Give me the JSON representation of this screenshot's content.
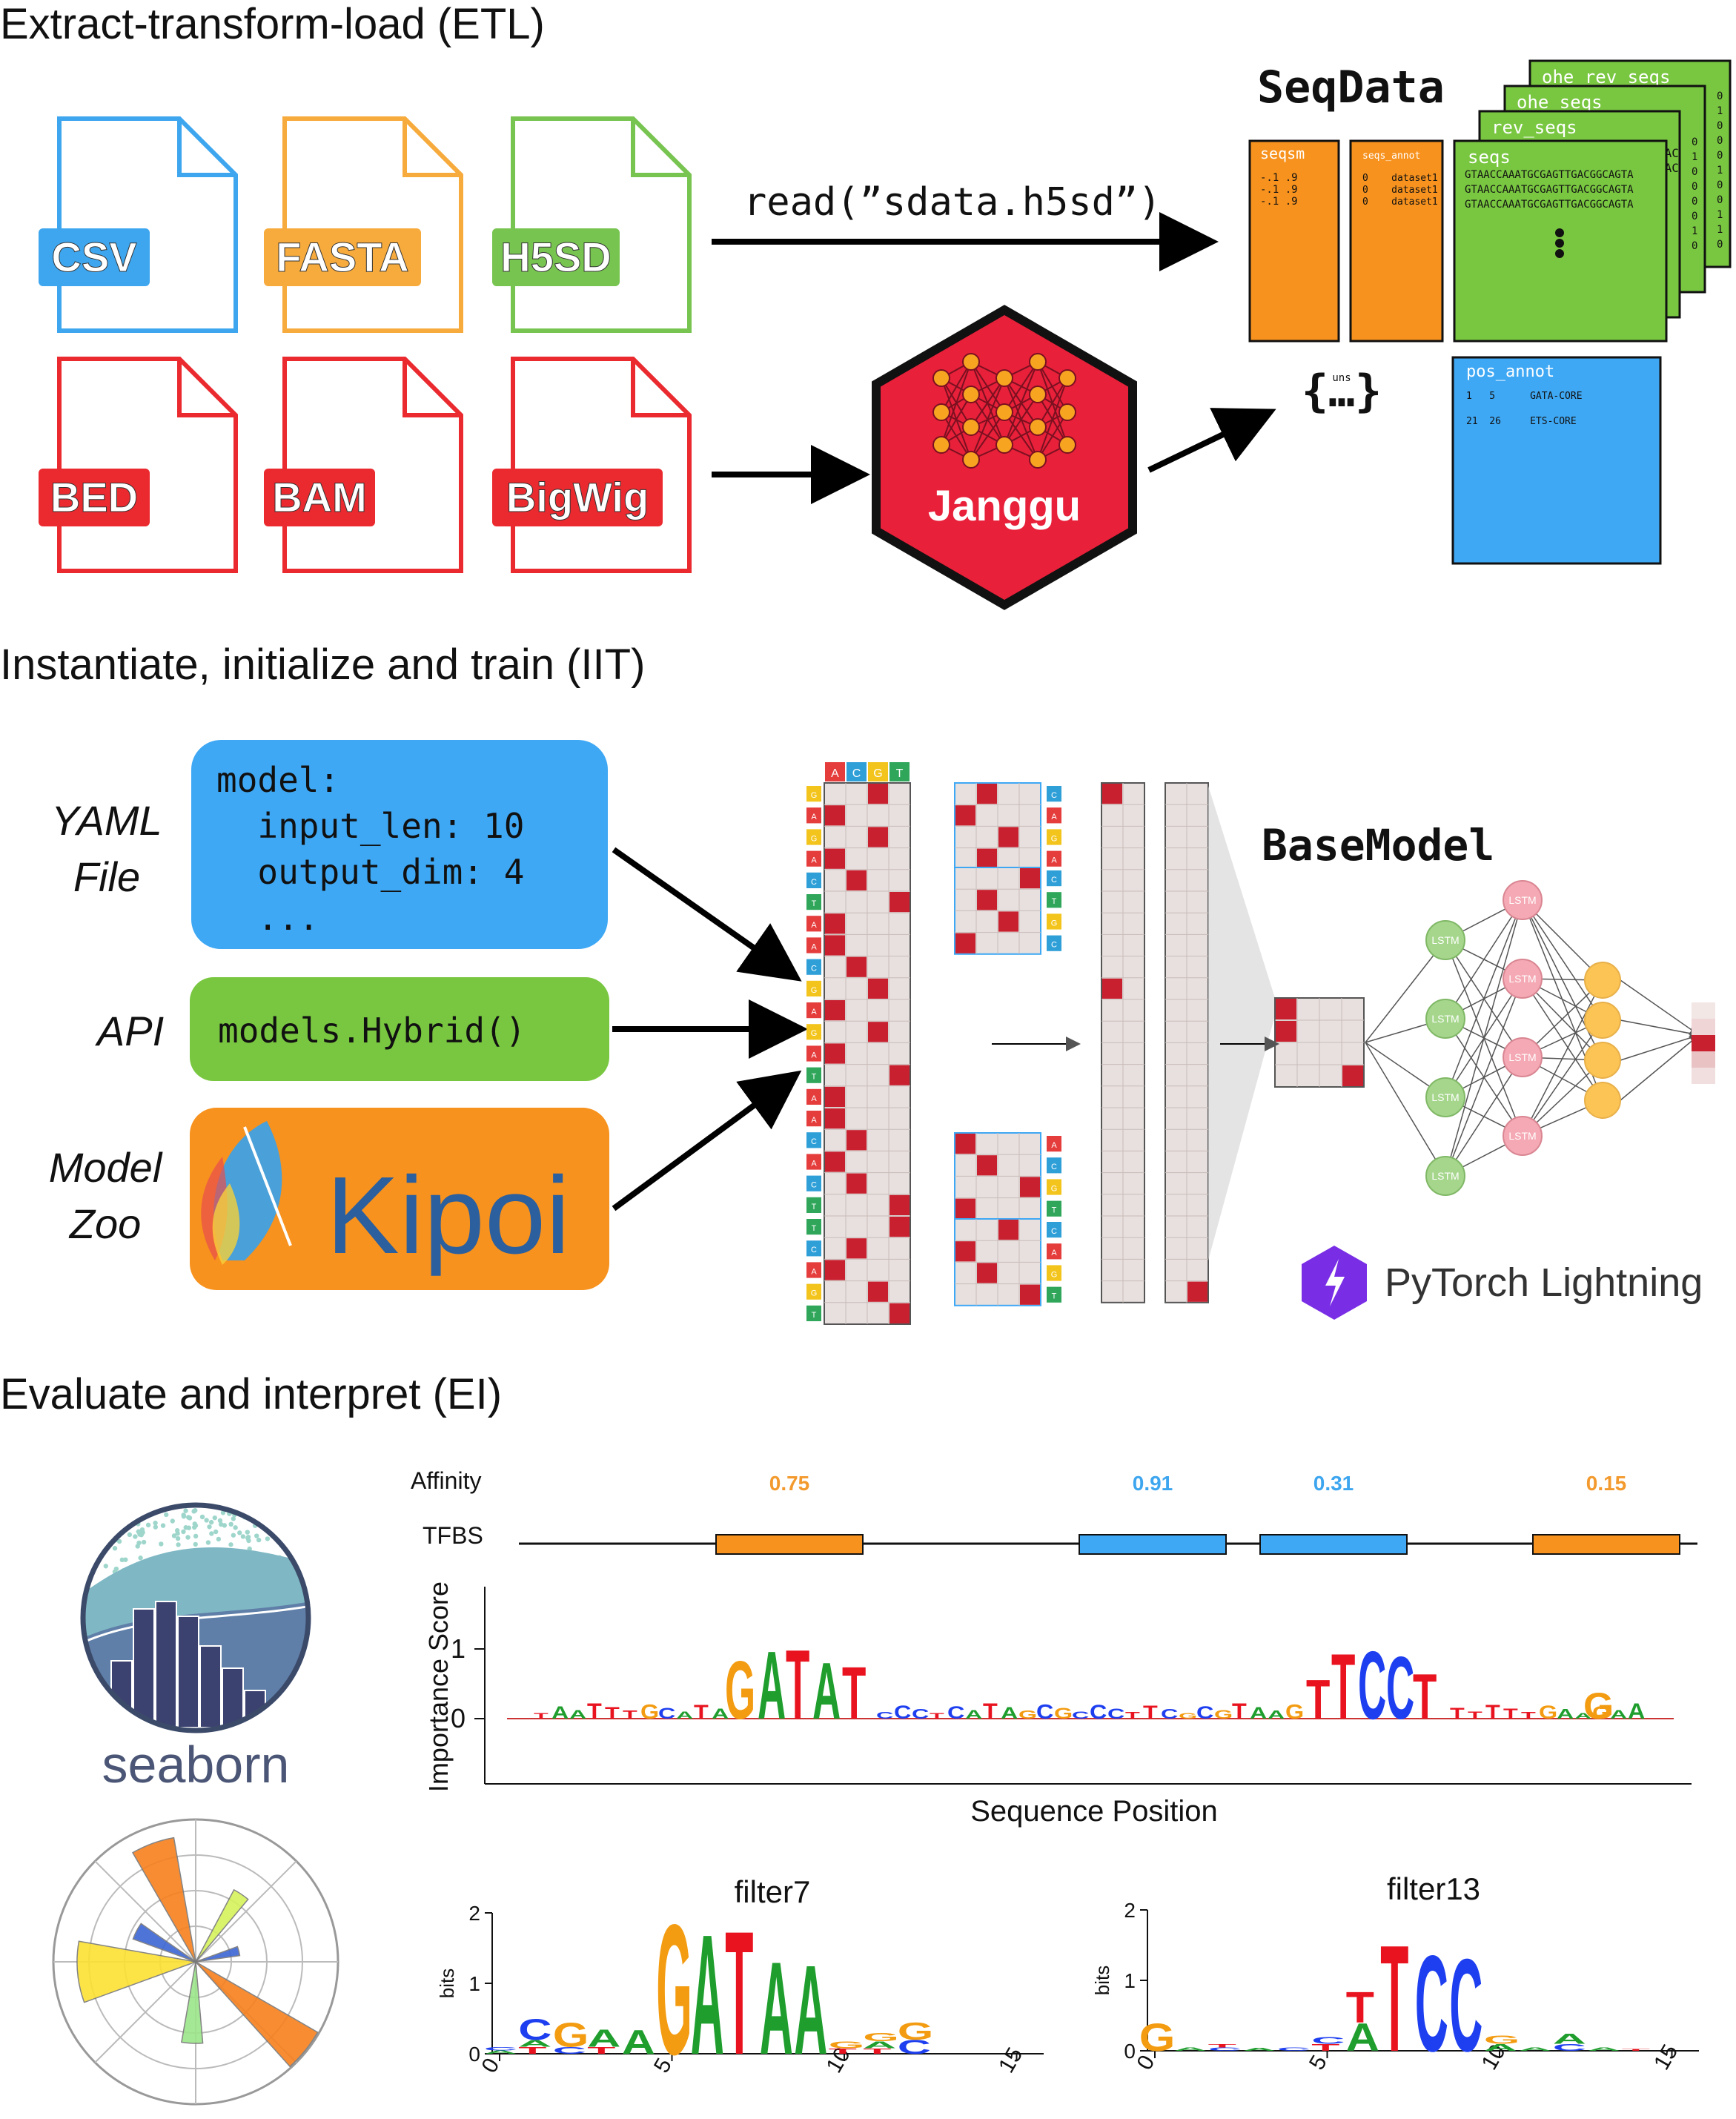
{
  "sections": {
    "etl": "Extract-transform-load (ETL)",
    "iit": "Instantiate, initialize and train (IIT)",
    "ei": "Evaluate and interpret (EI)"
  },
  "files": [
    {
      "label": "CSV",
      "color": "#3ea6ef"
    },
    {
      "label": "FASTA",
      "color": "#f7ab3d"
    },
    {
      "label": "H5SD",
      "color": "#78c451"
    },
    {
      "label": "BED",
      "color": "#ea2a2f"
    },
    {
      "label": "BAM",
      "color": "#ea2a2f"
    },
    {
      "label": "BigWig",
      "color": "#ea2a2f"
    }
  ],
  "read_call": "read(”sdata.h5sd”)",
  "janggu_label": "Janggu",
  "seqdata": {
    "title": "SeqData",
    "seqsm": {
      "header": "seqsm",
      "rows": [
        "-.1 .9",
        "-.1 .9",
        "-.1 .9"
      ]
    },
    "seqs_annot": {
      "header": "seqs_annot",
      "rows": [
        "0    dataset1",
        "0    dataset1",
        "0    dataset1"
      ]
    },
    "seqs": {
      "header": "seqs",
      "rows": [
        "GTAACCAAATGCGAGTTGACGGCAGTA",
        "GTAACCAAATGCGAGTTGACGGCAGTA",
        "GTAACCAAATGCGAGTTGACGGCAGTA"
      ]
    },
    "rev_seqs": "rev_seqs",
    "ohe_seqs": "ohe_seqs",
    "ohe_rev_seqs": "ohe_rev_seqs",
    "tac_fragment": "TAC",
    "uns_label": "uns",
    "uns_braces": "{…}",
    "pos_annot": {
      "header": "pos_annot",
      "rows": [
        "1   5      GATA-CORE",
        "21  26     ETS-CORE"
      ]
    }
  },
  "iit": {
    "yaml_label_1": "YAML",
    "yaml_label_2": "File",
    "yaml_code": [
      "model:",
      "  input_len: 10",
      "  output_dim: 4",
      "  ..."
    ],
    "api_label": "API",
    "api_code": "models.Hybrid()",
    "zoo_label_1": "Model",
    "zoo_label_2": "Zoo",
    "kipoi_label": "Kipoi",
    "basemodel_title": "BaseModel",
    "lightning_label": "PyTorch Lightning",
    "nucleotides": [
      "A",
      "C",
      "G",
      "T"
    ],
    "lstm_label": "LSTM",
    "seq_letters": [
      "G",
      "A",
      "G",
      "A",
      "C",
      "T",
      "A",
      "A",
      "C",
      "G",
      "A",
      "G",
      "A",
      "T",
      "A",
      "A",
      "C",
      "A",
      "C",
      "T",
      "T",
      "C",
      "A",
      "G",
      "T"
    ]
  },
  "ei": {
    "seaborn_label": "seaborn",
    "affinity_label": "Affinity",
    "tfbs_label": "TFBS",
    "affinities": [
      {
        "value": "0.75",
        "color": "#f39a2e"
      },
      {
        "value": "0.91",
        "color": "#3ea6ef"
      },
      {
        "value": "0.31",
        "color": "#3ea6ef"
      },
      {
        "value": "0.15",
        "color": "#f39a2e"
      }
    ],
    "importance_ylabel": "Importance Score",
    "importance_xlabel": "Sequence Position",
    "importance_yticks": [
      "1",
      "0"
    ],
    "filter7_title": "filter7",
    "filter13_title": "filter13",
    "bits_label": "bits",
    "logo_yticks": [
      "2",
      "1",
      "0"
    ],
    "logo_xticks": [
      "0",
      "5",
      "10",
      "15"
    ],
    "filter7_main": "GATAA",
    "filter13_main": "TCC"
  },
  "colors": {
    "orange": "#f7921e",
    "green": "#79c741",
    "blue": "#3fa8f4",
    "red": "#c8202f",
    "janggu_red": "#e8203a"
  }
}
